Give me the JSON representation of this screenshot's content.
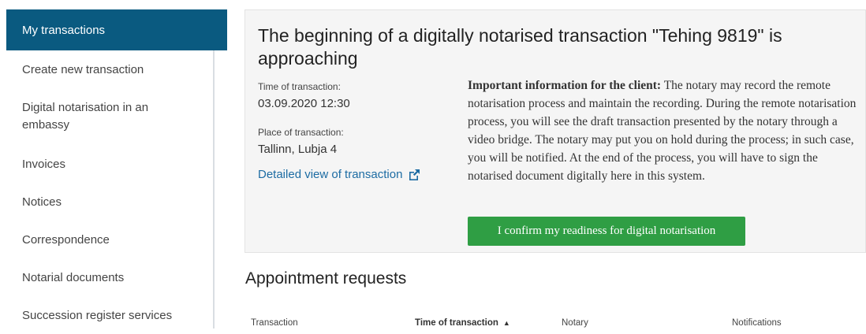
{
  "sidebar": {
    "items": [
      {
        "label": "My transactions",
        "active": true
      },
      {
        "label": "Create new transaction"
      },
      {
        "label": "Digital notarisation in an embassy"
      },
      {
        "label": "Invoices"
      },
      {
        "label": "Notices"
      },
      {
        "label": "Correspondence"
      },
      {
        "label": "Notarial documents"
      },
      {
        "label": "Succession register services"
      }
    ]
  },
  "notice": {
    "title": "The beginning of a digitally notarised transaction \"Tehing 9819\" is approaching",
    "time_label": "Time of transaction:",
    "time_value": "03.09.2020 12:30",
    "place_label": "Place of transaction:",
    "place_value": "Tallinn, Lubja 4",
    "detail_link": "Detailed view of transaction",
    "info_bold": "Important information for the client:",
    "info_text": " The notary may record the remote notarisation process and maintain the recording. During the remote notarisation process, you will see the draft transaction presented by the notary through a video bridge. The notary may put you on hold during the process; in such case, you will be notified. At the end of the process, you will have to sign the notarised document digitally here in this system.",
    "confirm_button": "I confirm my readiness for digital notarisation"
  },
  "appointments": {
    "title": "Appointment requests",
    "columns": [
      "Transaction",
      "Time of transaction",
      "Notary",
      "Notifications"
    ]
  },
  "colors": {
    "sidebar_active": "#0a5a80",
    "confirm_button": "#2f9e44",
    "link": "#1d6ca3"
  }
}
